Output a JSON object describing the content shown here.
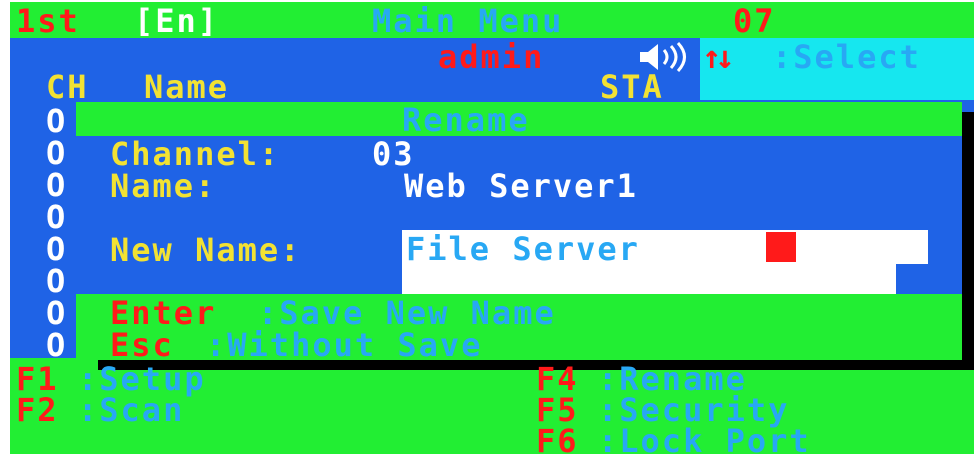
{
  "top_bar": {
    "page": "1st",
    "lang": "En",
    "title": "Main Menu",
    "number": "07"
  },
  "status": {
    "user": "admin",
    "speaker_icon": "speaker-icon",
    "arrows": "↑↓",
    "select_label": ":Select"
  },
  "columns": {
    "ch": "CH",
    "name": "Name",
    "sta": "STA"
  },
  "channel_list": {
    "marks": [
      "O",
      "O",
      "O",
      "O",
      "O",
      "O",
      "O",
      "O"
    ]
  },
  "dialog": {
    "title": "Rename",
    "channel_label": "Channel:",
    "channel_value": "03",
    "name_label": "Name:",
    "name_value": "Web Server1",
    "new_name_label": "New Name:",
    "new_name_value": "File Server",
    "enter_key": "Enter",
    "enter_action": ":Save New Name",
    "esc_key": "Esc",
    "esc_action": ":Without Save"
  },
  "function_keys": [
    {
      "key": "F1",
      "label": ":Setup"
    },
    {
      "key": "F2",
      "label": ":Scan"
    },
    {
      "key": "F4",
      "label": ":Rename"
    },
    {
      "key": "F5",
      "label": ":Security"
    },
    {
      "key": "F6",
      "label": ":Lock Port"
    }
  ],
  "colors": {
    "green": "#22ee33",
    "blue": "#1f63e6",
    "cyan": "#16e7ef",
    "red": "#ff1a1a",
    "yellow": "#f2e233",
    "light_blue": "#28a8f4"
  }
}
